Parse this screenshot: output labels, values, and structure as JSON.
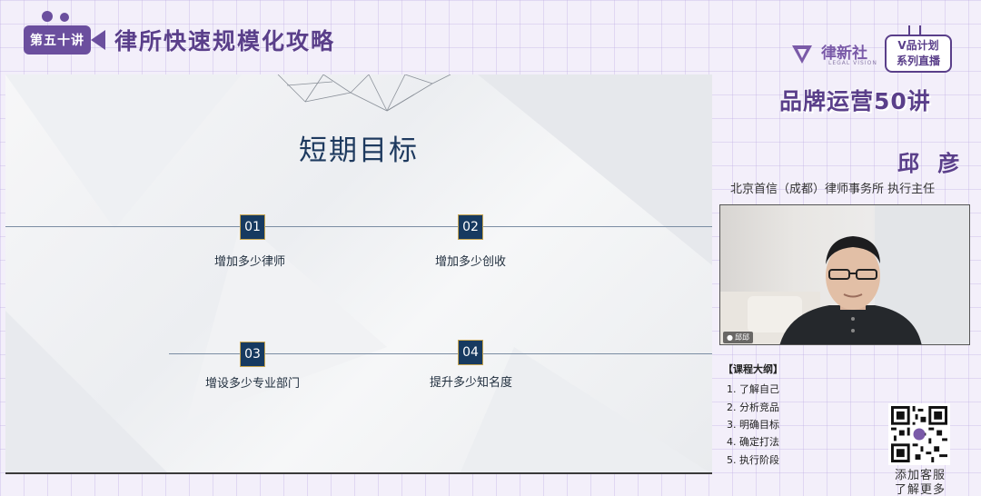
{
  "header": {
    "lecture_badge": "第五十讲",
    "title": "律所快速规模化攻略"
  },
  "slide": {
    "title": "短期目标",
    "goals": [
      {
        "num": "01",
        "label": "增加多少律师"
      },
      {
        "num": "02",
        "label": "增加多少创收"
      },
      {
        "num": "03",
        "label": "增设多少专业部门"
      },
      {
        "num": "04",
        "label": "提升多少知名度"
      }
    ]
  },
  "side": {
    "logo_text": "律新社",
    "logo_sub": "LEGAL VISION",
    "vplan_line1": "V品计划",
    "vplan_line2": "系列直播",
    "brand_title": "品牌运营50讲",
    "speaker_name": "邱 彦",
    "speaker_affiliation": "北京首信（成都）律师事务所 执行主任",
    "camera_tag": "邱邱",
    "outline_heading": "【课程大纲】",
    "outline": [
      "1. 了解自己",
      "2. 分析竞品",
      "3. 明确目标",
      "4. 确定打法",
      "5. 执行阶段"
    ],
    "qr_caption_line1": "添加客服",
    "qr_caption_line2": "了解更多"
  },
  "colors": {
    "brand_purple": "#5a3f8a",
    "badge_purple": "#6b4f9e",
    "slide_navy": "#173a60",
    "box_border": "#c7a550"
  }
}
